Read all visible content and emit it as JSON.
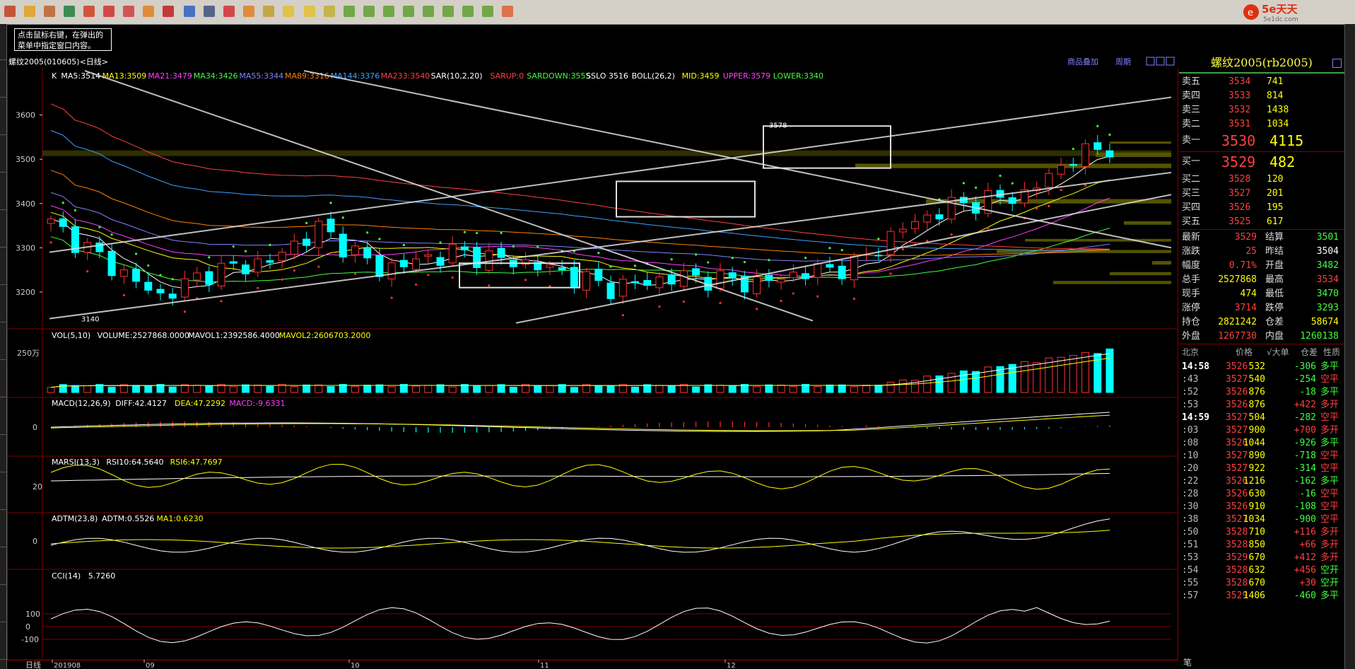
{
  "hint": {
    "line1": "点击鼠标右键，在弹出的",
    "line2": "菜单中指定窗口内容。"
  },
  "brand": {
    "name": "5e天天",
    "sub": "5e1dc.com"
  },
  "header": {
    "title": "螺纹2005(010605)<日线>",
    "link_overlay": "商品叠加",
    "link_period": "周期"
  },
  "main_legend": [
    {
      "text": "K",
      "color": "#ffffff"
    },
    {
      "text": "MA5:3514",
      "color": "#ffffff"
    },
    {
      "text": "MA13:3509",
      "color": "#ffff00"
    },
    {
      "text": "MA21:3479",
      "color": "#ff40ff"
    },
    {
      "text": "MA34:3426",
      "color": "#40ff40"
    },
    {
      "text": "MA55:3344",
      "color": "#8080ff"
    },
    {
      "text": "MA89:3316",
      "color": "#ff8000"
    },
    {
      "text": "MA144:3376",
      "color": "#40a0ff"
    },
    {
      "text": "MA233:3540",
      "color": "#ff4040"
    },
    {
      "text": "SAR(10,2,20)",
      "color": "#ffffff"
    },
    {
      "text": "SARUP:0",
      "color": "#ff4040"
    },
    {
      "text": "SARDOWN:3555",
      "color": "#40ff40"
    },
    {
      "text": "SSLO 3516",
      "color": "#ffffff"
    },
    {
      "text": "BOLL(26,2)",
      "color": "#ffffff"
    },
    {
      "text": "MID:3459",
      "color": "#ffff00"
    },
    {
      "text": "UPPER:3579",
      "color": "#ff40ff"
    },
    {
      "text": "LOWER:3340",
      "color": "#40ff40"
    }
  ],
  "price_axis": [
    "3600",
    "3500",
    "3400",
    "3300",
    "3200"
  ],
  "annotations": {
    "low": "3140",
    "high": "3578"
  },
  "vol_legend": [
    {
      "text": "VOL(5,10)",
      "color": "#ffffff"
    },
    {
      "text": "VOLUME:2527868.0000",
      "color": "#ffffff"
    },
    {
      "text": "MAVOL1:2392586.4000",
      "color": "#ffffff"
    },
    {
      "text": "MAVOL2:2606703.2000",
      "color": "#ffff00"
    }
  ],
  "vol_axis": "250万",
  "macd_legend": [
    {
      "text": "MACD(12,26,9)",
      "color": "#ffffff"
    },
    {
      "text": "DIFF:42.4127",
      "color": "#ffffff"
    },
    {
      "text": "DEA:47.2292",
      "color": "#ffff00"
    },
    {
      "text": "MACD:-9.6331",
      "color": "#ff40ff"
    }
  ],
  "macd_axis": "0",
  "marsi_legend": [
    {
      "text": "MARSI(13,3)",
      "color": "#ffffff"
    },
    {
      "text": "RSI10:64.5640",
      "color": "#ffffff"
    },
    {
      "text": "RSI6:47.7697",
      "color": "#ffff00"
    }
  ],
  "marsi_axis": "20",
  "adtm_legend": [
    {
      "text": "ADTM(23,8)",
      "color": "#ffffff"
    },
    {
      "text": "ADTM:0.5526",
      "color": "#ffffff"
    },
    {
      "text": "MA1:0.6230",
      "color": "#ffff00"
    }
  ],
  "adtm_axis": "0",
  "cci_legend": [
    {
      "text": "CCI(14)",
      "color": "#ffffff"
    },
    {
      "text": "5.7260",
      "color": "#ffffff"
    }
  ],
  "cci_axis": [
    "100",
    "0",
    "-100"
  ],
  "time_axis": {
    "label": "日线",
    "ticks": [
      "201908",
      "09",
      "10",
      "11",
      "12"
    ]
  },
  "quote": {
    "title": "螺纹2005(rb2005)",
    "asks": [
      {
        "label": "卖五",
        "price": "3534",
        "vol": "741"
      },
      {
        "label": "卖四",
        "price": "3533",
        "vol": "814"
      },
      {
        "label": "卖三",
        "price": "3532",
        "vol": "1438"
      },
      {
        "label": "卖二",
        "price": "3531",
        "vol": "1034"
      },
      {
        "label": "卖一",
        "price": "3530",
        "vol": "4115"
      }
    ],
    "bids": [
      {
        "label": "买一",
        "price": "3529",
        "vol": "482"
      },
      {
        "label": "买二",
        "price": "3528",
        "vol": "120"
      },
      {
        "label": "买三",
        "price": "3527",
        "vol": "201"
      },
      {
        "label": "买四",
        "price": "3526",
        "vol": "195"
      },
      {
        "label": "买五",
        "price": "3525",
        "vol": "617"
      }
    ],
    "stats": [
      {
        "l1": "最新",
        "v1": "3529",
        "c1": "#ff4040",
        "l2": "结算",
        "v2": "3501",
        "c2": "#40ff40"
      },
      {
        "l1": "涨跌",
        "v1": "25",
        "c1": "#ff4040",
        "l2": "昨结",
        "v2": "3504",
        "c2": "#ffffff"
      },
      {
        "l1": "幅度",
        "v1": "0.71%",
        "c1": "#ff4040",
        "l2": "开盘",
        "v2": "3482",
        "c2": "#40ff40"
      },
      {
        "l1": "总手",
        "v1": "2527868",
        "c1": "#ffff00",
        "l2": "最高",
        "v2": "3534",
        "c2": "#ff4040"
      },
      {
        "l1": "现手",
        "v1": "474",
        "c1": "#ffff00",
        "l2": "最低",
        "v2": "3470",
        "c2": "#40ff40"
      },
      {
        "l1": "涨停",
        "v1": "3714",
        "c1": "#ff4040",
        "l2": "跌停",
        "v2": "3293",
        "c2": "#40ff40"
      },
      {
        "l1": "持仓",
        "v1": "2821242",
        "c1": "#ffff00",
        "l2": "仓差",
        "v2": "58674",
        "c2": "#ffff00"
      },
      {
        "l1": "外盘",
        "v1": "1267730",
        "c1": "#ff4040",
        "l2": "内盘",
        "v2": "1260138",
        "c2": "#40ff40"
      }
    ],
    "ticks_header": [
      "北京",
      "价格",
      "√大单",
      "仓差",
      "性质"
    ],
    "ticks": [
      {
        "t": "14:58",
        "p": "3526",
        "v": "532",
        "d": "-306",
        "n": "多平",
        "pc": "#ff4040",
        "nc": "#40ff40"
      },
      {
        "t": ":43",
        "p": "3527",
        "v": "540",
        "d": "-254",
        "n": "空平",
        "pc": "#ff4040",
        "nc": "#ff4040"
      },
      {
        "t": ":52",
        "p": "3526",
        "v": "876",
        "d": "-18",
        "n": "多平",
        "pc": "#ff4040",
        "nc": "#40ff40"
      },
      {
        "t": ":53",
        "p": "3526",
        "v": "876",
        "d": "+422",
        "n": "多开",
        "pc": "#ff4040",
        "nc": "#ff4040"
      },
      {
        "t": "14:59",
        "p": "3527",
        "v": "504",
        "d": "-282",
        "n": "空平",
        "pc": "#ff4040",
        "nc": "#ff4040"
      },
      {
        "t": ":03",
        "p": "3527",
        "v": "900",
        "d": "+700",
        "n": "多开",
        "pc": "#ff4040",
        "nc": "#ff4040"
      },
      {
        "t": ":08",
        "p": "3526",
        "v": "1044",
        "d": "-926",
        "n": "多平",
        "pc": "#ff4040",
        "nc": "#40ff40"
      },
      {
        "t": ":10",
        "p": "3527",
        "v": "890",
        "d": "-718",
        "n": "空平",
        "pc": "#ff4040",
        "nc": "#ff4040"
      },
      {
        "t": ":20",
        "p": "3527",
        "v": "922",
        "d": "-314",
        "n": "空平",
        "pc": "#ff4040",
        "nc": "#ff4040"
      },
      {
        "t": ":22",
        "p": "3526",
        "v": "1216",
        "d": "-162",
        "n": "多平",
        "pc": "#ff4040",
        "nc": "#40ff40"
      },
      {
        "t": ":28",
        "p": "3526",
        "v": "630",
        "d": "-16",
        "n": "空平",
        "pc": "#ff4040",
        "nc": "#ff4040"
      },
      {
        "t": ":30",
        "p": "3526",
        "v": "910",
        "d": "-108",
        "n": "空平",
        "pc": "#ff4040",
        "nc": "#ff4040"
      },
      {
        "t": ":38",
        "p": "3527",
        "v": "1034",
        "d": "-900",
        "n": "空平",
        "pc": "#ff4040",
        "nc": "#ff4040"
      },
      {
        "t": ":50",
        "p": "3528",
        "v": "710",
        "d": "+116",
        "n": "多开",
        "pc": "#ff4040",
        "nc": "#ff4040"
      },
      {
        "t": ":51",
        "p": "3528",
        "v": "850",
        "d": "+66",
        "n": "多开",
        "pc": "#ff4040",
        "nc": "#ff4040"
      },
      {
        "t": ":53",
        "p": "3529",
        "v": "670",
        "d": "+412",
        "n": "多开",
        "pc": "#ff4040",
        "nc": "#ff4040"
      },
      {
        "t": ":54",
        "p": "3528",
        "v": "632",
        "d": "+456",
        "n": "空开",
        "pc": "#ff4040",
        "nc": "#40ff40"
      },
      {
        "t": ":55",
        "p": "3528",
        "v": "670",
        "d": "+30",
        "n": "空开",
        "pc": "#ff4040",
        "nc": "#40ff40"
      },
      {
        "t": ":57",
        "p": "3529",
        "v": "1406",
        "d": "-460",
        "n": "多平",
        "pc": "#ff4040",
        "nc": "#40ff40"
      }
    ],
    "bottom_tab": "笔"
  },
  "colors": {
    "up": "#ff3030",
    "down": "#00ffff",
    "ma5": "#ffffff",
    "ma13": "#ffff00",
    "ma21": "#ff40ff",
    "ma34": "#40ff40",
    "ma55": "#8080ff",
    "ma89": "#ff8000",
    "ma144": "#40a0ff",
    "ma233": "#ff4040",
    "grid": "#800000"
  }
}
